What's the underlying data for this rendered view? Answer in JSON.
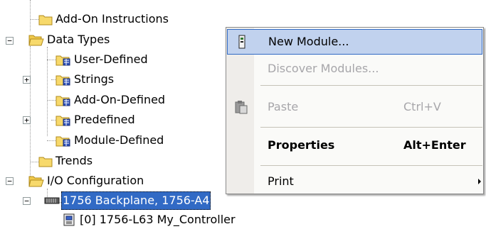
{
  "tree": {
    "items": [
      {
        "label": "Add-On Instructions",
        "icon": "folder-icon"
      },
      {
        "label": "Data Types",
        "icon": "open-folder-icon"
      },
      {
        "label": "User-Defined",
        "icon": "data-type-folder-icon"
      },
      {
        "label": "Strings",
        "icon": "data-type-folder-icon"
      },
      {
        "label": "Add-On-Defined",
        "icon": "data-type-folder-icon"
      },
      {
        "label": "Predefined",
        "icon": "data-type-folder-icon"
      },
      {
        "label": "Module-Defined",
        "icon": "data-type-folder-icon"
      },
      {
        "label": "Trends",
        "icon": "folder-icon"
      },
      {
        "label": "I/O Configuration",
        "icon": "open-folder-icon"
      },
      {
        "label": "1756 Backplane, 1756-A4",
        "icon": "backplane-icon"
      },
      {
        "label": "[0] 1756-L63 My_Controller",
        "icon": "controller-icon"
      }
    ],
    "expander_minus": "−",
    "expander_plus": "+"
  },
  "context_menu": {
    "items": [
      {
        "label": "New Module...",
        "shortcut": "",
        "icon": "new-module-icon"
      },
      {
        "label": "Discover Modules...",
        "shortcut": ""
      },
      {
        "label": "Paste",
        "shortcut": "Ctrl+V",
        "icon": "paste-icon"
      },
      {
        "label": "Properties",
        "shortcut": "Alt+Enter"
      },
      {
        "label": "Print",
        "shortcut": "",
        "icon": "submenu-arrow-icon"
      }
    ]
  },
  "colors": {
    "selection": "#316ac5",
    "menu_highlight": "#c1d2ee",
    "disabled_text": "#a7a6aa"
  }
}
